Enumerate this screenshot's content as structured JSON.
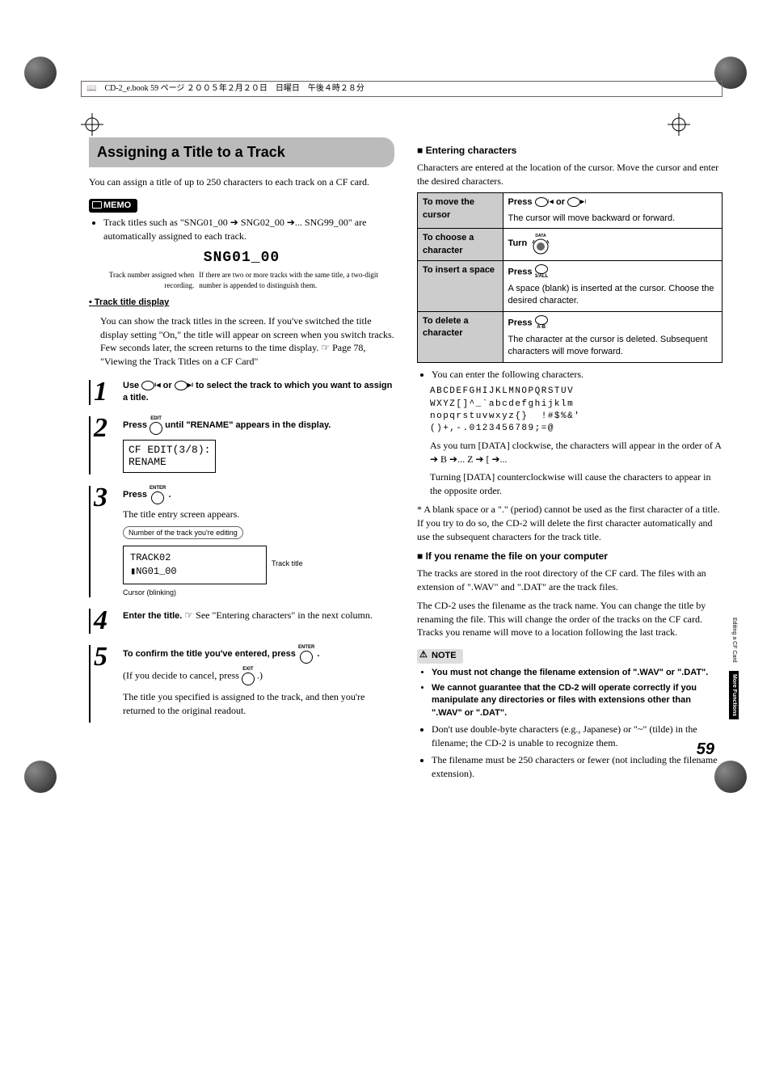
{
  "topbar": "CD-2_e.book  59 ページ  ２００５年２月２０日　日曜日　午後４時２８分",
  "page_number": "59",
  "section_title": "Assigning a Title to a Track",
  "intro": "You can assign a title of up to 250 characters to each track on a CF card.",
  "memo_label": "MEMO",
  "memo_items": [
    "Track titles such as \"SNG01_00 ➔ SNG02_00 ➔... SNG99_00\" are automatically assigned to each track."
  ],
  "lcd_title": "SNG01_00",
  "caption_left": "Track number assigned when recording.",
  "caption_right": "If there are two or more tracks with the same title, a two-digit number is appended to distinguish them.",
  "track_title_heading_bullet": "•",
  "track_title_heading": "Track title display",
  "track_title_body": "You can show the track titles in the screen. If you've switched the title display setting \"On,\" the title will appear on screen when you switch tracks. Few seconds later, the screen returns to the time display. ☞ Page 78, \"Viewing the Track Titles on a CF Card\"",
  "steps": [
    {
      "num": "1",
      "pre": "Use ",
      "mid": " or ",
      "post": " to select the track to which you want to assign a title.",
      "btn1_sub": "",
      "btn2_sub": ""
    },
    {
      "num": "2",
      "pre": "Press ",
      "btn_label": "EDIT",
      "post": " until \"RENAME\" appears in the display.",
      "lcd_line1": "CF EDIT(3/8):",
      "lcd_line2": "RENAME"
    },
    {
      "num": "3",
      "pre": "Press ",
      "btn_label": "ENTER",
      "post": " .",
      "plain_after": "The title entry screen appears.",
      "diagram_cap": "Number of the track you're editing",
      "diagram_line1": "TRACK02",
      "diagram_line2": "▮NG01_00",
      "diagram_right": "Track title",
      "diagram_bottom": "Cursor (blinking)"
    },
    {
      "num": "4",
      "pre": "Enter the title. ",
      "ref": "☞ See \"Entering characters\" in the next column.",
      "plain_font": true
    },
    {
      "num": "5",
      "pre": "To confirm the title you've entered, press ",
      "btn_label": "ENTER",
      "post": " .",
      "plain_after_inline_pre": "(If you decide to cancel, press ",
      "plain_after_btn_label": "EXIT",
      "plain_after_inline_post": " .)",
      "final": "The title you specified is assigned to the track, and then you're returned to the original readout."
    }
  ],
  "right": {
    "entering_chars_heading": "Entering characters",
    "entering_chars_intro": "Characters are entered at the location of the cursor. Move the cursor and enter the desired characters.",
    "table_rows": [
      {
        "label": "To move the cursor",
        "action_pre": "Press ",
        "has_two_ellipse": true,
        "mid": " or ",
        "desc": "The cursor will move backward or forward."
      },
      {
        "label": "To choose a character",
        "action_pre": "Turn ",
        "knob_label": "DATA",
        "has_dial": true,
        "desc": ""
      },
      {
        "label": "To insert a space",
        "action_pre": "Press ",
        "btn_sub": "1/ALL",
        "desc": "A space (blank) is inserted at the cursor. Choose the desired character."
      },
      {
        "label": "To delete a character",
        "action_pre": "Press ",
        "btn_sub": "A-B",
        "desc": "The character at the cursor is deleted. Subsequent characters will move forward."
      }
    ],
    "charset_intro": "You can enter the following characters.",
    "charset_lines": "ABCDEFGHIJKLMNOPQRSTUV\nWXYZ[]^_`abcdefghijklm\nnopqrstuvwxyz{}  !#$%&'\n()+,-.0123456789;=@",
    "charset_note1": "As you turn [DATA] clockwise, the characters will appear in the order of A ➔ B ➔... Z ➔ [ ➔...",
    "charset_note2": "Turning [DATA] counterclockwise will cause the characters to appear in the opposite order.",
    "charset_star": "*  A blank space or a \".\" (period) cannot be used as the first character of a title. If you try to do so, the CD-2 will delete the first character automatically and use the subsequent characters for the track title.",
    "rename_heading": "If you rename the file on your computer",
    "rename_p1": "The tracks are stored in the root directory of the CF card. The files with an extension of \".WAV\" and \".DAT\" are the track files.",
    "rename_p2": "The CD-2 uses the filename as the track name. You can change the title by renaming the file. This will change the order of the tracks on the CF card. Tracks you rename will move to a location following the last track.",
    "note_label": "NOTE",
    "note_items": [
      "You must not change the filename extension of \".WAV\" or \".DAT\".",
      "We cannot guarantee that the CD-2 will operate correctly if you manipulate any directories or files with extensions other than \".WAV\" or \".DAT\".",
      "Don't use double-byte characters (e.g., Japanese) or \"~\" (tilde) in the filename; the CD-2 is unable to recognize them.",
      "The filename must be 250 characters or fewer (not including the filename extension)."
    ]
  },
  "side_tabs": {
    "t1": "Editing a CF Card",
    "t2": "More Functions"
  }
}
